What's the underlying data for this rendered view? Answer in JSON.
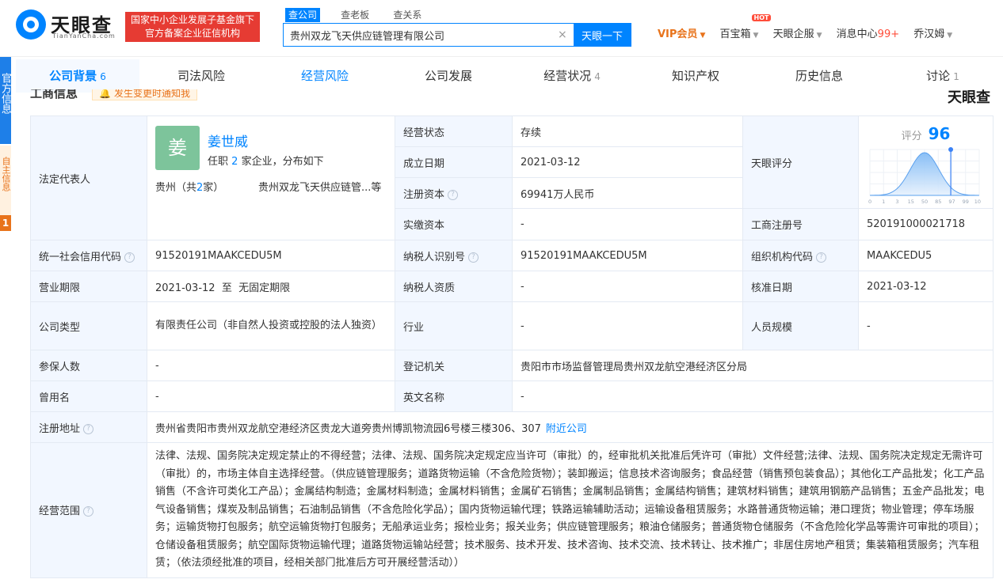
{
  "header": {
    "logo_text": "天眼查",
    "logo_sub": "TianYanCha.com",
    "gov_badge_line1": "国家中小企业发展子基金旗下",
    "gov_badge_line2": "官方备案企业征信机构",
    "search_tabs": [
      "查公司",
      "查老板",
      "查关系"
    ],
    "search_value": "贵州双龙飞天供应链管理有限公司",
    "search_button": "天眼一下",
    "nav": {
      "vip": "VIP会员",
      "baibaoxiang": "百宝箱",
      "hot": "HOT",
      "qiye": "天眼企服",
      "msg_label": "消息中心",
      "msg_count": "99+",
      "user": "乔汉姆"
    }
  },
  "side": {
    "blue_text": "官方信息",
    "orange_text": "自主信息",
    "num": "1"
  },
  "tabs": [
    {
      "label": "公司背景",
      "count": "6"
    },
    {
      "label": "司法风险",
      "count": ""
    },
    {
      "label": "经营风险",
      "count": ""
    },
    {
      "label": "公司发展",
      "count": ""
    },
    {
      "label": "经营状况",
      "count": "4"
    },
    {
      "label": "知识产权",
      "count": ""
    },
    {
      "label": "历史信息",
      "count": ""
    },
    {
      "label": "讨论",
      "count": "1"
    }
  ],
  "section": {
    "title": "工商信息",
    "notify": "发生变更时通知我",
    "watermark": "天眼查"
  },
  "legal": {
    "label": "法定代表人",
    "avatar_char": "姜",
    "name": "姜世威",
    "role_pre": "任职",
    "role_num": "2",
    "role_post": "家企业，分布如下",
    "region_pre": "贵州（共",
    "region_num": "2",
    "region_post": "家）",
    "company": "贵州双龙飞天供应链管...等"
  },
  "fields": {
    "status_lbl": "经营状态",
    "status": "存续",
    "found_lbl": "成立日期",
    "found": "2021-03-12",
    "capital_lbl": "注册资本",
    "capital": "69941万人民币",
    "paid_lbl": "实缴资本",
    "paid": "-",
    "score_lbl": "天眼评分",
    "score_head": "评分",
    "score": "96",
    "regno_lbl": "工商注册号",
    "regno": "520191000021718",
    "credit_lbl": "统一社会信用代码",
    "credit": "91520191MAAKCEDU5M",
    "tax_lbl": "纳税人识别号",
    "tax": "91520191MAAKCEDU5M",
    "org_lbl": "组织机构代码",
    "org": "MAAKCEDU5",
    "term_lbl": "营业期限",
    "term": "2021-03-12  至  无固定期限",
    "taxq_lbl": "纳税人资质",
    "taxq": "-",
    "approve_lbl": "核准日期",
    "approve": "2021-03-12",
    "type_lbl": "公司类型",
    "type": "有限责任公司（非自然人投资或控股的法人独资）",
    "industry_lbl": "行业",
    "industry": "-",
    "staff_lbl": "人员规模",
    "staff": "-",
    "insured_lbl": "参保人数",
    "insured": "-",
    "authority_lbl": "登记机关",
    "authority": "贵阳市市场监督管理局贵州双龙航空港经济区分局",
    "former_lbl": "曾用名",
    "former": "-",
    "english_lbl": "英文名称",
    "english": "-",
    "addr_lbl": "注册地址",
    "addr": "贵州省贵阳市贵州双龙航空港经济区贵龙大道旁贵州博凯物流园6号楼三楼306、307",
    "nearby": "附近公司",
    "scope_lbl": "经营范围",
    "scope": "法律、法规、国务院决定规定禁止的不得经营；法律、法规、国务院决定规定应当许可（审批）的，经审批机关批准后凭许可（审批）文件经营;法律、法规、国务院决定规定无需许可（审批）的，市场主体自主选择经营。（供应链管理服务；道路货物运输（不含危险货物）；装卸搬运；信息技术咨询服务；食品经营（销售预包装食品）；其他化工产品批发；化工产品销售（不含许可类化工产品）；金属结构制造；金属材料制造；金属材料销售；金属矿石销售；金属制品销售；金属结构销售；建筑材料销售；建筑用钢筋产品销售；五金产品批发；电气设备销售；煤炭及制品销售；石油制品销售（不含危险化学品）；国内货物运输代理；铁路运输辅助活动；运输设备租赁服务；水路普通货物运输；港口理货；物业管理；停车场服务；运输货物打包服务；航空运输货物打包服务；无船承运业务；报检业务；报关业务；供应链管理服务；粮油仓储服务；普通货物仓储服务（不含危险化学品等需许可审批的项目）；仓储设备租赁服务；航空国际货物运输代理；道路货物运输站经营；技术服务、技术开发、技术咨询、技术交流、技术转让、技术推广；非居住房地产租赁；集装箱租赁服务；汽车租赁；（依法须经批准的项目，经相关部门批准后方可开展经营活动））"
  },
  "chart_data": {
    "type": "area",
    "title": "评分",
    "x_ticks": [
      "0",
      "1",
      "3",
      "15",
      "50",
      "85",
      "97",
      "99",
      "100"
    ],
    "marker_value": 96,
    "xlabel": "",
    "ylabel": ""
  }
}
